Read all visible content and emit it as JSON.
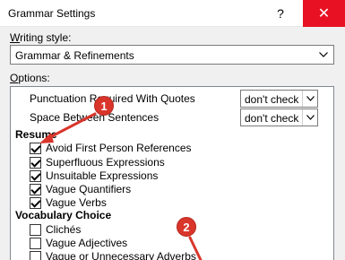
{
  "window": {
    "title": "Grammar Settings",
    "help_label": "?",
    "close_label": "✕"
  },
  "writing_style": {
    "label_prefix": "",
    "label_underlined": "W",
    "label_rest": "riting style:",
    "value": "Grammar & Refinements"
  },
  "options": {
    "label_underlined": "O",
    "label_rest": "ptions:",
    "dropdown_rows": [
      {
        "label": "Punctuation Required With Quotes",
        "value": "don't check"
      },
      {
        "label": "Space Between Sentences",
        "value": "don't check"
      }
    ],
    "groups": [
      {
        "title": "Resume",
        "items": [
          {
            "label": "Avoid First Person References",
            "checked": true
          },
          {
            "label": "Superfluous Expressions",
            "checked": true
          },
          {
            "label": "Unsuitable Expressions",
            "checked": true
          },
          {
            "label": "Vague Quantifiers",
            "checked": true
          },
          {
            "label": "Vague Verbs",
            "checked": true
          }
        ]
      },
      {
        "title": "Vocabulary Choice",
        "items": [
          {
            "label": "Clichés",
            "checked": false
          },
          {
            "label": "Vague Adjectives",
            "checked": false
          },
          {
            "label": "Vague or Unnecessary Adverbs",
            "checked": false
          }
        ]
      }
    ]
  },
  "callouts": [
    "1",
    "2"
  ],
  "colors": {
    "callout": "#d9352b",
    "close_hover": "#e81123"
  }
}
